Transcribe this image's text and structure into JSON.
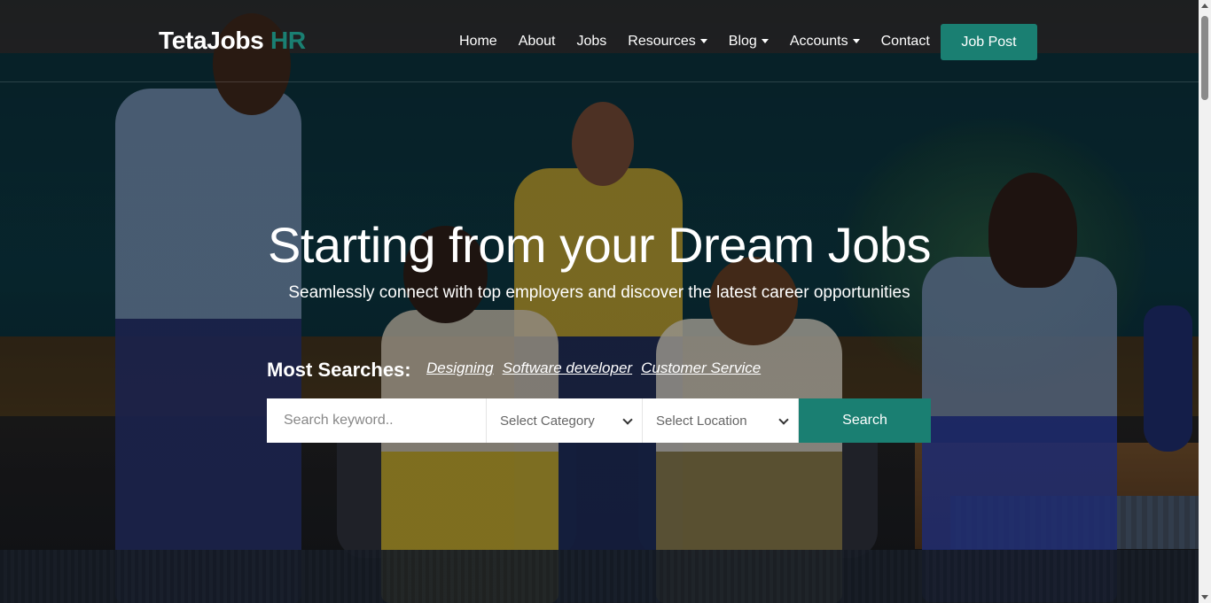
{
  "brand": {
    "name": "TetaJobs",
    "accent": "HR",
    "accent_color": "#1a7f72"
  },
  "nav": {
    "items": [
      {
        "label": "Home",
        "dropdown": false
      },
      {
        "label": "About",
        "dropdown": false
      },
      {
        "label": "Jobs",
        "dropdown": false
      },
      {
        "label": "Resources",
        "dropdown": true
      },
      {
        "label": "Blog",
        "dropdown": true
      },
      {
        "label": "Accounts",
        "dropdown": true
      },
      {
        "label": "Contact",
        "dropdown": false
      }
    ],
    "cta_label": "Job Post"
  },
  "hero": {
    "headline": "Starting from your Dream Jobs",
    "subline": "Seamlessly connect with top employers and discover the latest career opportunities"
  },
  "most_searches": {
    "label": "Most Searches:",
    "links": [
      "Designing",
      "Software developer",
      "Customer Service"
    ]
  },
  "search": {
    "keyword_placeholder": "Search keyword..",
    "category_label": "Select Category",
    "location_label": "Select Location",
    "button_label": "Search"
  },
  "colors": {
    "primary": "#1a7f72",
    "text": "#ffffff"
  }
}
